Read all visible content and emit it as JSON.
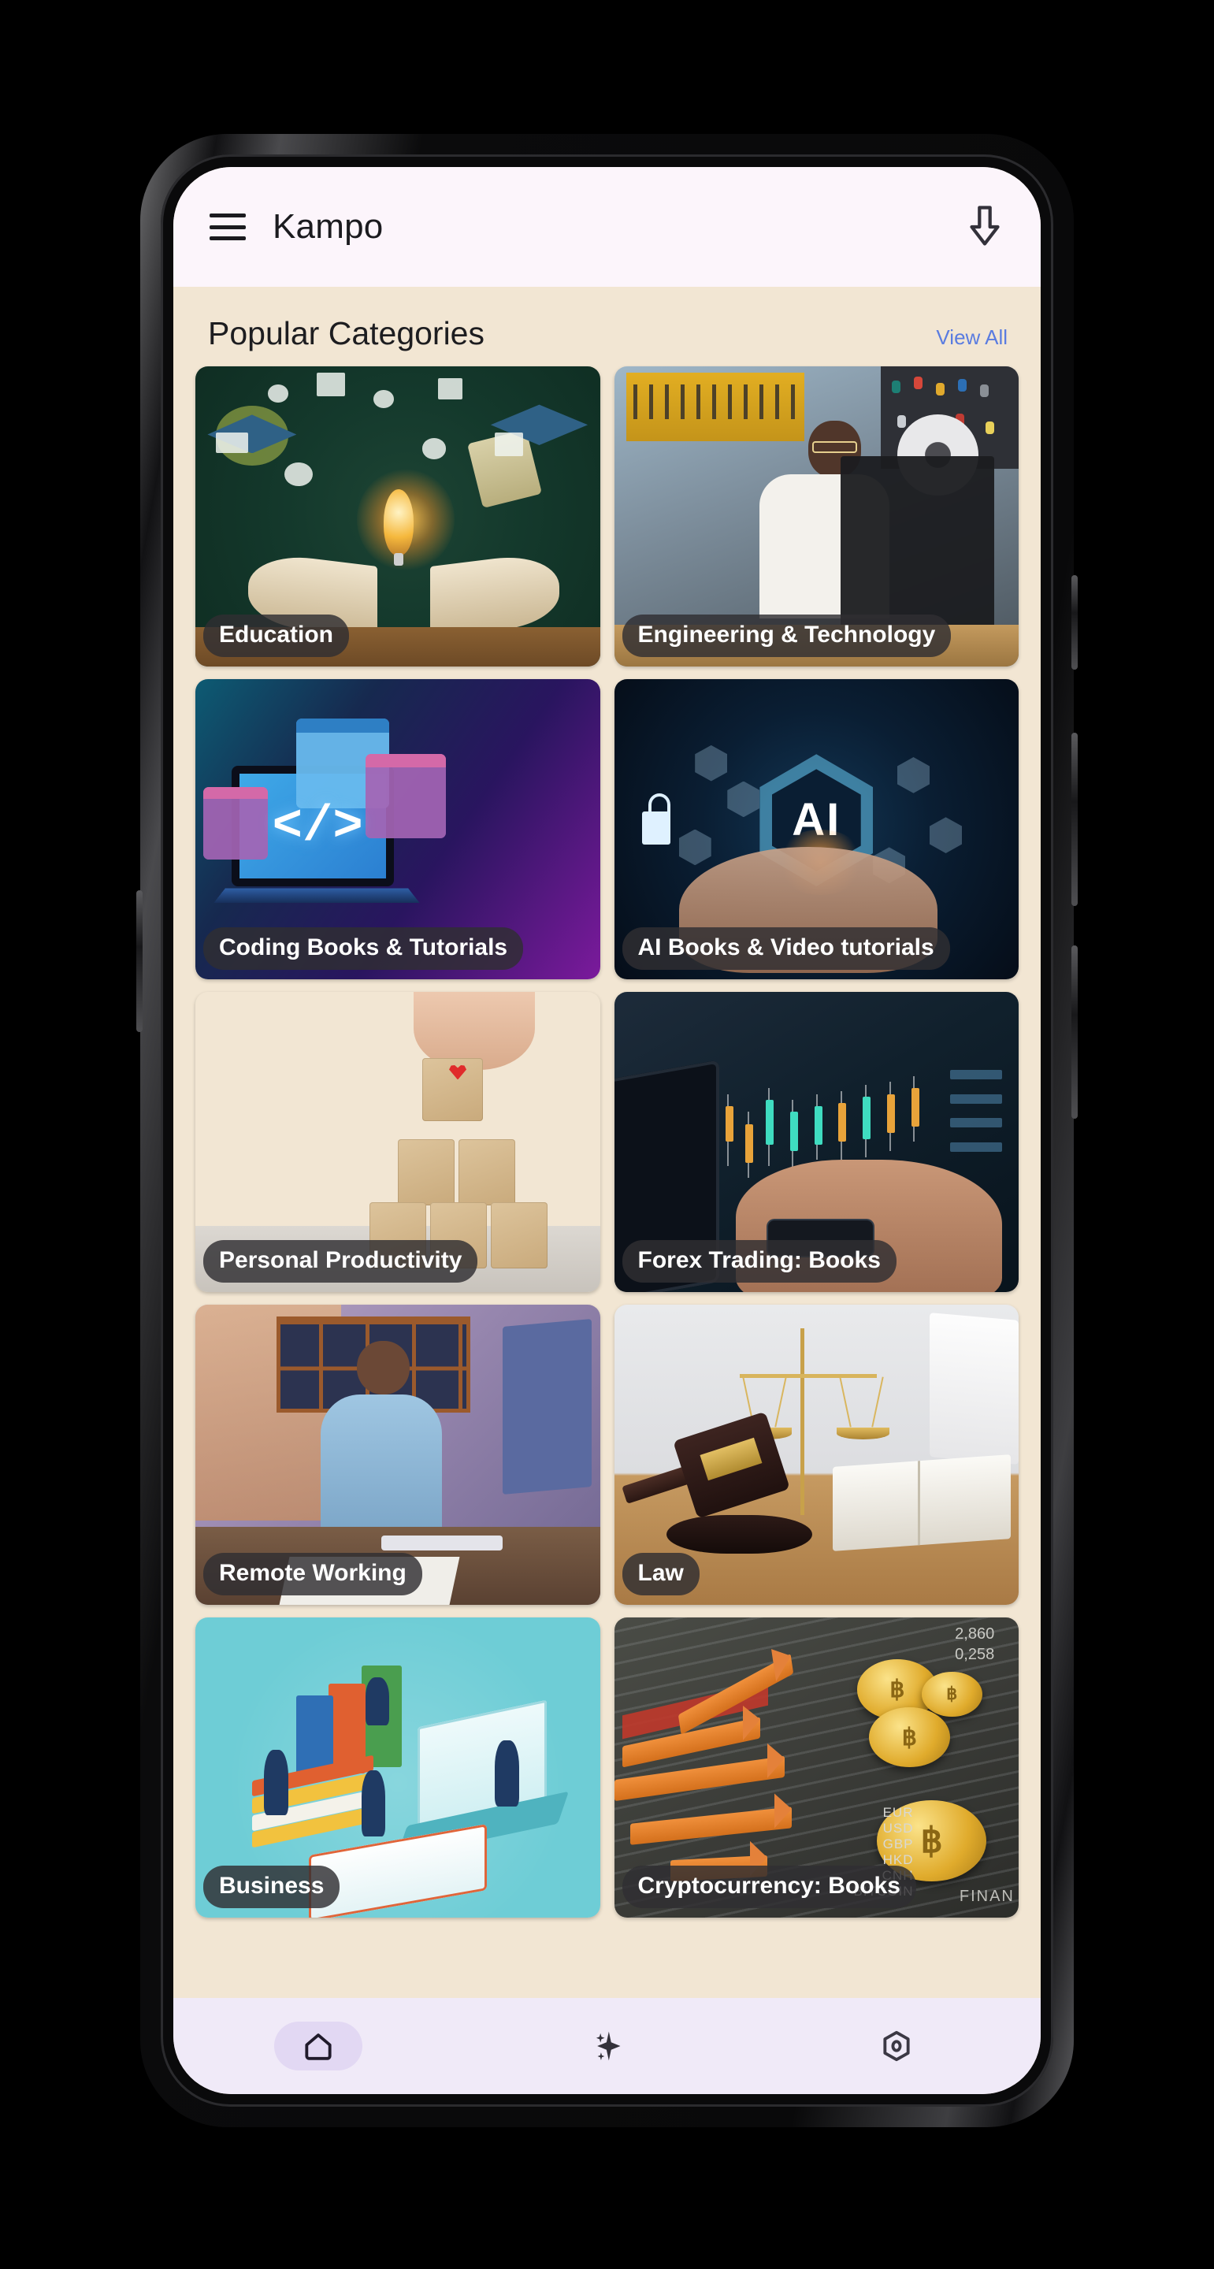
{
  "app": {
    "title": "Kampo",
    "menu_icon": "hamburger-menu-icon",
    "download_icon": "download-arrow-icon"
  },
  "section": {
    "title": "Popular Categories",
    "view_all": "View All"
  },
  "colors": {
    "page_background": "#f2e6d3",
    "appbar_background": "#fcf5fb",
    "bottomnav_background": "#f0eaf8",
    "link_accent": "#5a7ce0",
    "label_pill": "#302e32",
    "nav_active_pill": "#e2d8f3"
  },
  "categories": [
    {
      "label": "Education",
      "art": "education"
    },
    {
      "label": "Engineering  & Technology",
      "art": "eng"
    },
    {
      "label": "Coding Books & Tutorials",
      "art": "coding"
    },
    {
      "label": "AI Books & Video tutorials",
      "art": "ai"
    },
    {
      "label": "Personal Productivity",
      "art": "prod"
    },
    {
      "label": "Forex Trading: Books",
      "art": "forex"
    },
    {
      "label": "Remote Working",
      "art": "remote"
    },
    {
      "label": "Law",
      "art": "law"
    },
    {
      "label": "Business",
      "art": "business"
    },
    {
      "label": "Cryptocurrency: Books",
      "art": "crypto"
    }
  ],
  "artwork_text": {
    "coding_code_tag": "</>",
    "ai_badge": "AI",
    "crypto_currencies": "EUR\nUSD\nGBP\nHKD\nCNH\nBITCOIN",
    "crypto_top_numbers": "2,860\n0,258",
    "crypto_finance": "FINAN"
  },
  "bottom_nav": [
    {
      "icon": "home-icon",
      "active": true
    },
    {
      "icon": "sparkle-icon",
      "active": false
    },
    {
      "icon": "hexagon-gem-icon",
      "active": false
    }
  ]
}
